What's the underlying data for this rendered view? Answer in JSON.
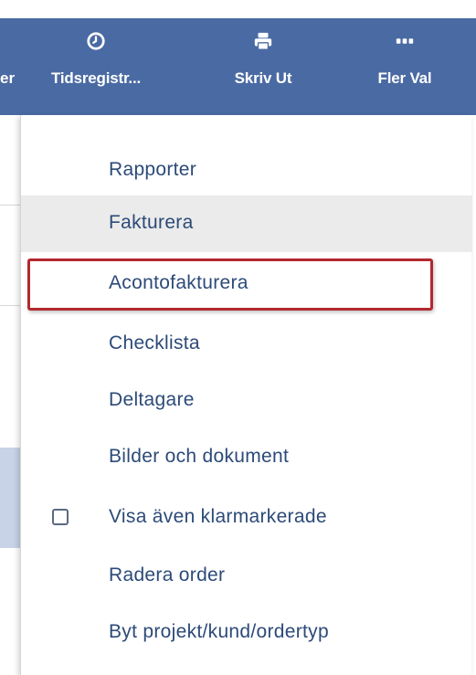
{
  "toolbar": {
    "cut_label": "er",
    "items": [
      {
        "label": "Tidsregistr...",
        "icon": "clock-icon"
      },
      {
        "label": "Skriv Ut",
        "icon": "printer-icon"
      },
      {
        "label": "Fler Val",
        "icon": "more-icon"
      }
    ]
  },
  "menu": {
    "items": [
      {
        "label": "Rapporter"
      },
      {
        "label": "Fakturera"
      },
      {
        "label": "Acontofakturera"
      },
      {
        "label": "Checklista"
      },
      {
        "label": "Deltagare"
      },
      {
        "label": "Bilder och dokument"
      },
      {
        "label": "Visa även klarmarkerade",
        "checkbox": false
      },
      {
        "label": "Radera order"
      },
      {
        "label": "Byt projekt/kund/ordertyp"
      }
    ]
  },
  "colors": {
    "toolbar_bg": "#4a6aa3",
    "menu_text": "#2c4a78",
    "highlight_border": "#b3282f",
    "hover_bg": "#ebebeb"
  }
}
